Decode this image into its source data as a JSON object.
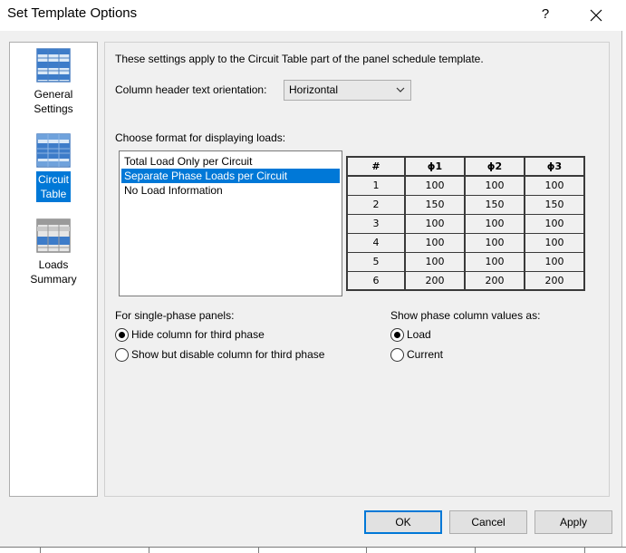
{
  "window": {
    "title": "Set Template Options",
    "help_label": "?",
    "close_icon": "close-icon"
  },
  "nav": {
    "items": [
      {
        "label": "General\nSettings",
        "icon": "grid-table-icon",
        "selected": false
      },
      {
        "label": "Circuit\nTable",
        "icon": "circuit-table-icon",
        "selected": true
      },
      {
        "label": "Loads\nSummary",
        "icon": "loads-summary-icon",
        "selected": false
      }
    ]
  },
  "main": {
    "info_text": "These settings apply to the Circuit Table part of the panel schedule template.",
    "orientation_label": "Column header text orientation:",
    "orientation_value": "Horizontal",
    "format_label": "Choose format for displaying loads:",
    "format_options": [
      {
        "label": "Total Load Only per Circuit",
        "selected": false
      },
      {
        "label": "Separate Phase Loads per Circuit",
        "selected": true
      },
      {
        "label": "No Load Information",
        "selected": false
      }
    ],
    "preview": {
      "headers": [
        "#",
        "ϕ1",
        "ϕ2",
        "ϕ3"
      ],
      "rows": [
        [
          "1",
          "100",
          "100",
          "100"
        ],
        [
          "2",
          "150",
          "150",
          "150"
        ],
        [
          "3",
          "100",
          "100",
          "100"
        ],
        [
          "4",
          "100",
          "100",
          "100"
        ],
        [
          "5",
          "100",
          "100",
          "100"
        ],
        [
          "6",
          "200",
          "200",
          "200"
        ]
      ]
    },
    "single_phase": {
      "label": "For single-phase panels:",
      "options": [
        {
          "label": "Hide column for third phase",
          "checked": true
        },
        {
          "label": "Show but disable column for third phase",
          "checked": false
        }
      ]
    },
    "phase_values": {
      "label": "Show phase column values as:",
      "options": [
        {
          "label": "Load",
          "checked": true
        },
        {
          "label": "Current",
          "checked": false
        }
      ]
    }
  },
  "buttons": {
    "ok": "OK",
    "cancel": "Cancel",
    "apply": "Apply"
  },
  "colors": {
    "accent": "#0078d7",
    "dialog_bg": "#f0f0f0"
  }
}
